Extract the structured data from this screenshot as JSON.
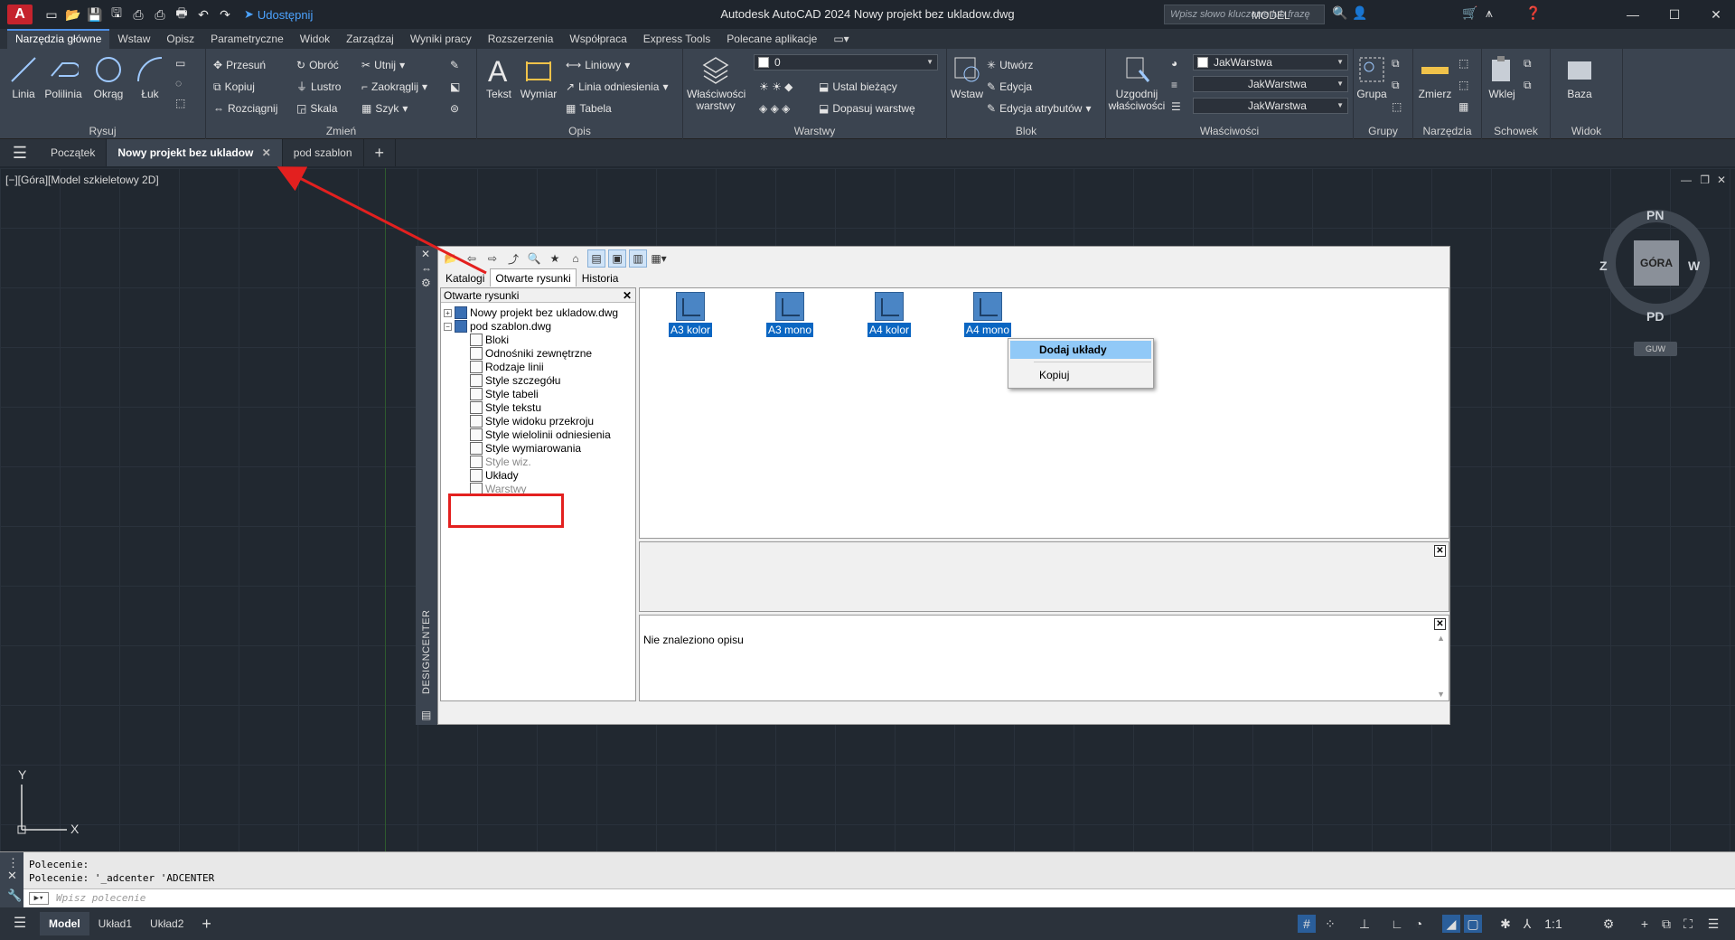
{
  "window": {
    "title": "Autodesk AutoCAD 2024   Nowy projekt bez ukladow.dwg",
    "share_label": "Udostępnij",
    "search_placeholder": "Wpisz słowo kluczowe lub frazę",
    "app_letter": "A"
  },
  "ribbon_tabs": [
    "Narzędzia główne",
    "Wstaw",
    "Opisz",
    "Parametryczne",
    "Widok",
    "Zarządzaj",
    "Wyniki pracy",
    "Rozszerzenia",
    "Współpraca",
    "Express Tools",
    "Polecane aplikacje"
  ],
  "ribbon": {
    "draw": {
      "title": "Rysuj",
      "line": "Linia",
      "polyline": "Polilinia",
      "circle": "Okrąg",
      "arc": "Łuk"
    },
    "modify": {
      "title": "Zmień",
      "move": "Przesuń",
      "rotate": "Obróć",
      "trim": "Utnij",
      "copy": "Kopiuj",
      "mirror": "Lustro",
      "fillet": "Zaokrąglij",
      "stretch": "Rozciągnij",
      "scale": "Skala",
      "array": "Szyk"
    },
    "annotation": {
      "title": "Opis",
      "text": "Tekst",
      "dimension": "Wymiar",
      "linear": "Liniowy",
      "leader": "Linia odniesienia",
      "table": "Tabela"
    },
    "layers": {
      "title": "Warstwy",
      "props": "Właściwości warstwy",
      "current_layer": "0",
      "set_current": "Ustal bieżący",
      "match": "Dopasuj warstwę"
    },
    "block": {
      "title": "Blok",
      "insert": "Wstaw",
      "create": "Utwórz",
      "edit": "Edycja",
      "edit_attr": "Edycja atrybutów"
    },
    "properties": {
      "title": "Właściwości",
      "match": "Uzgodnij właściwości",
      "color": "JakWarstwa",
      "linetype": "JakWarstwa",
      "lineweight": "JakWarstwa"
    },
    "groups": {
      "title": "Grupy",
      "group": "Grupa"
    },
    "utilities": {
      "title": "Narzędzia",
      "measure": "Zmierz"
    },
    "clipboard": {
      "title": "Schowek",
      "paste": "Wklej"
    },
    "view": {
      "title": "Widok",
      "base": "Baza"
    }
  },
  "file_tabs": [
    "Początek",
    "Nowy projekt bez ukladow",
    "pod szablon"
  ],
  "viewport_label": "[−][Góra][Model szkieletowy 2D]",
  "viewcube": {
    "top": "GÓRA",
    "north": "PN",
    "south": "PD",
    "west": "Z",
    "east": "W",
    "wcs": "GUW"
  },
  "designcenter": {
    "side_label": "DESIGNCENTER",
    "tabs": [
      "Katalogi",
      "Otwarte rysunki",
      "Historia"
    ],
    "tree_header": "Otwarte rysunki",
    "tree": {
      "file1": "Nowy projekt bez ukladow.dwg",
      "file2": "pod szablon.dwg",
      "children": [
        "Bloki",
        "Odnośniki zewnętrzne",
        "Rodzaje linii",
        "Style szczegółu",
        "Style tabeli",
        "Style tekstu",
        "Style widoku przekroju",
        "Style wielolinii odniesienia",
        "Style wymiarowania",
        "Style wiz.",
        "Układy",
        "Warstwy"
      ]
    },
    "palette_items": [
      "A3 kolor",
      "A3 mono",
      "A4 kolor",
      "A4 mono"
    ],
    "description": "Nie znaleziono opisu"
  },
  "context_menu": {
    "add": "Dodaj układy",
    "copy": "Kopiuj"
  },
  "command": {
    "history": [
      "Polecenie:",
      "Polecenie: '_adcenter 'ADCENTER"
    ],
    "placeholder": "Wpisz polecenie"
  },
  "status": {
    "layout_tabs": [
      "Model",
      "Układ1",
      "Układ2"
    ],
    "model_label": "MODEL",
    "scale": "1:1"
  }
}
